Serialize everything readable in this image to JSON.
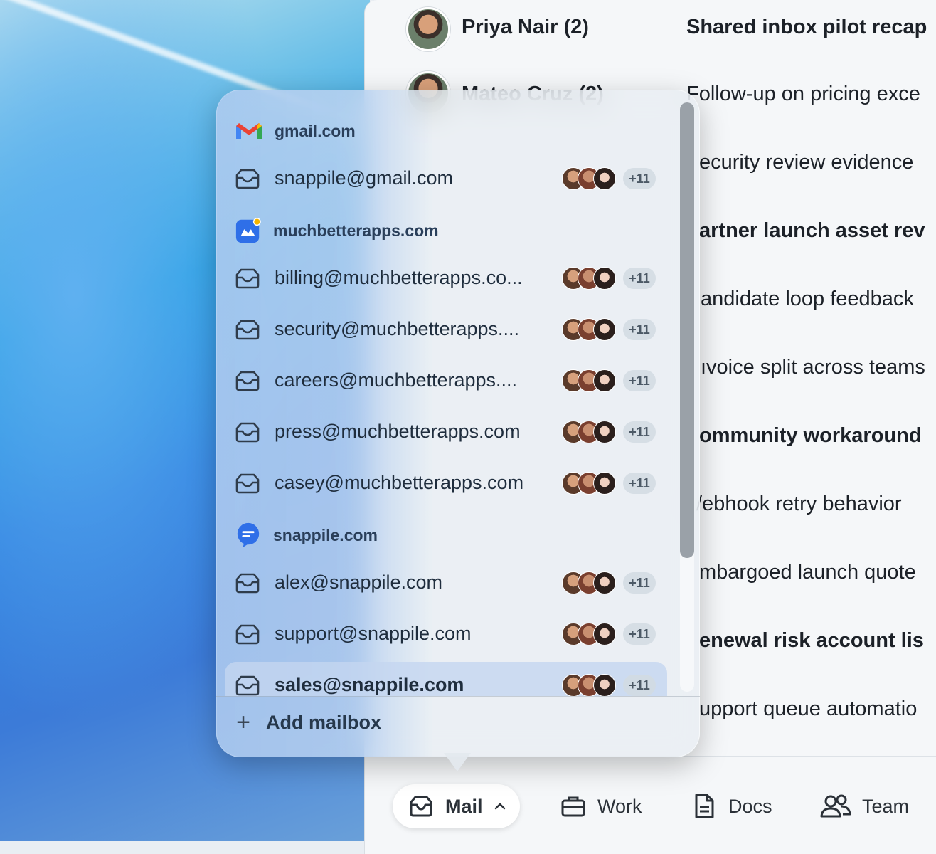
{
  "messages": [
    {
      "sender": "Priya Nair (2)",
      "subject": "Shared inbox pilot recap",
      "bold": true
    },
    {
      "sender": "Mateo Cruz (2)",
      "subject": "Follow-up on pricing exce",
      "bold": false
    },
    {
      "sender": "",
      "subject": "ecurity review evidence",
      "bold": false
    },
    {
      "sender": "",
      "subject": "artner launch asset rev",
      "bold": true
    },
    {
      "sender": "",
      "subject": "andidate loop feedback",
      "bold": false
    },
    {
      "sender": "",
      "subject": "ıvoice split across teams",
      "bold": false
    },
    {
      "sender": "",
      "subject": "ommunity workaround",
      "bold": true
    },
    {
      "sender": "",
      "subject": "/ebhook retry behavior",
      "bold": false
    },
    {
      "sender": "",
      "subject": "mbargoed launch quote",
      "bold": false
    },
    {
      "sender": "",
      "subject": "enewal risk account lis",
      "bold": true
    },
    {
      "sender": "",
      "subject": "upport queue automatio",
      "bold": false
    }
  ],
  "popover": {
    "domains": [
      {
        "label": "gmail.com",
        "icon": "gmail-icon"
      },
      {
        "label": "muchbetterapps.com",
        "icon": "muchbetterapps-icon"
      },
      {
        "label": "snappile.com",
        "icon": "snappile-icon"
      }
    ],
    "mailboxes": [
      {
        "label": "snappile@gmail.com",
        "more": "+11"
      },
      {
        "label": "billing@muchbetterapps.co...",
        "more": "+11"
      },
      {
        "label": "security@muchbetterapps....",
        "more": "+11"
      },
      {
        "label": "careers@muchbetterapps....",
        "more": "+11"
      },
      {
        "label": "press@muchbetterapps.com",
        "more": "+11"
      },
      {
        "label": "casey@muchbetterapps.com",
        "more": "+11"
      },
      {
        "label": "alex@snappile.com",
        "more": "+11"
      },
      {
        "label": "support@snappile.com",
        "more": "+11"
      },
      {
        "label": "sales@snappile.com",
        "more": "+11"
      }
    ],
    "add_label": "Add mailbox"
  },
  "tabs": {
    "mail": "Mail",
    "work": "Work",
    "docs": "Docs",
    "team": "Team"
  },
  "colors": {
    "accent_selected": "#c4d6f0",
    "gmail_red": "#ea4335",
    "brand_blue": "#2f6fe8"
  }
}
